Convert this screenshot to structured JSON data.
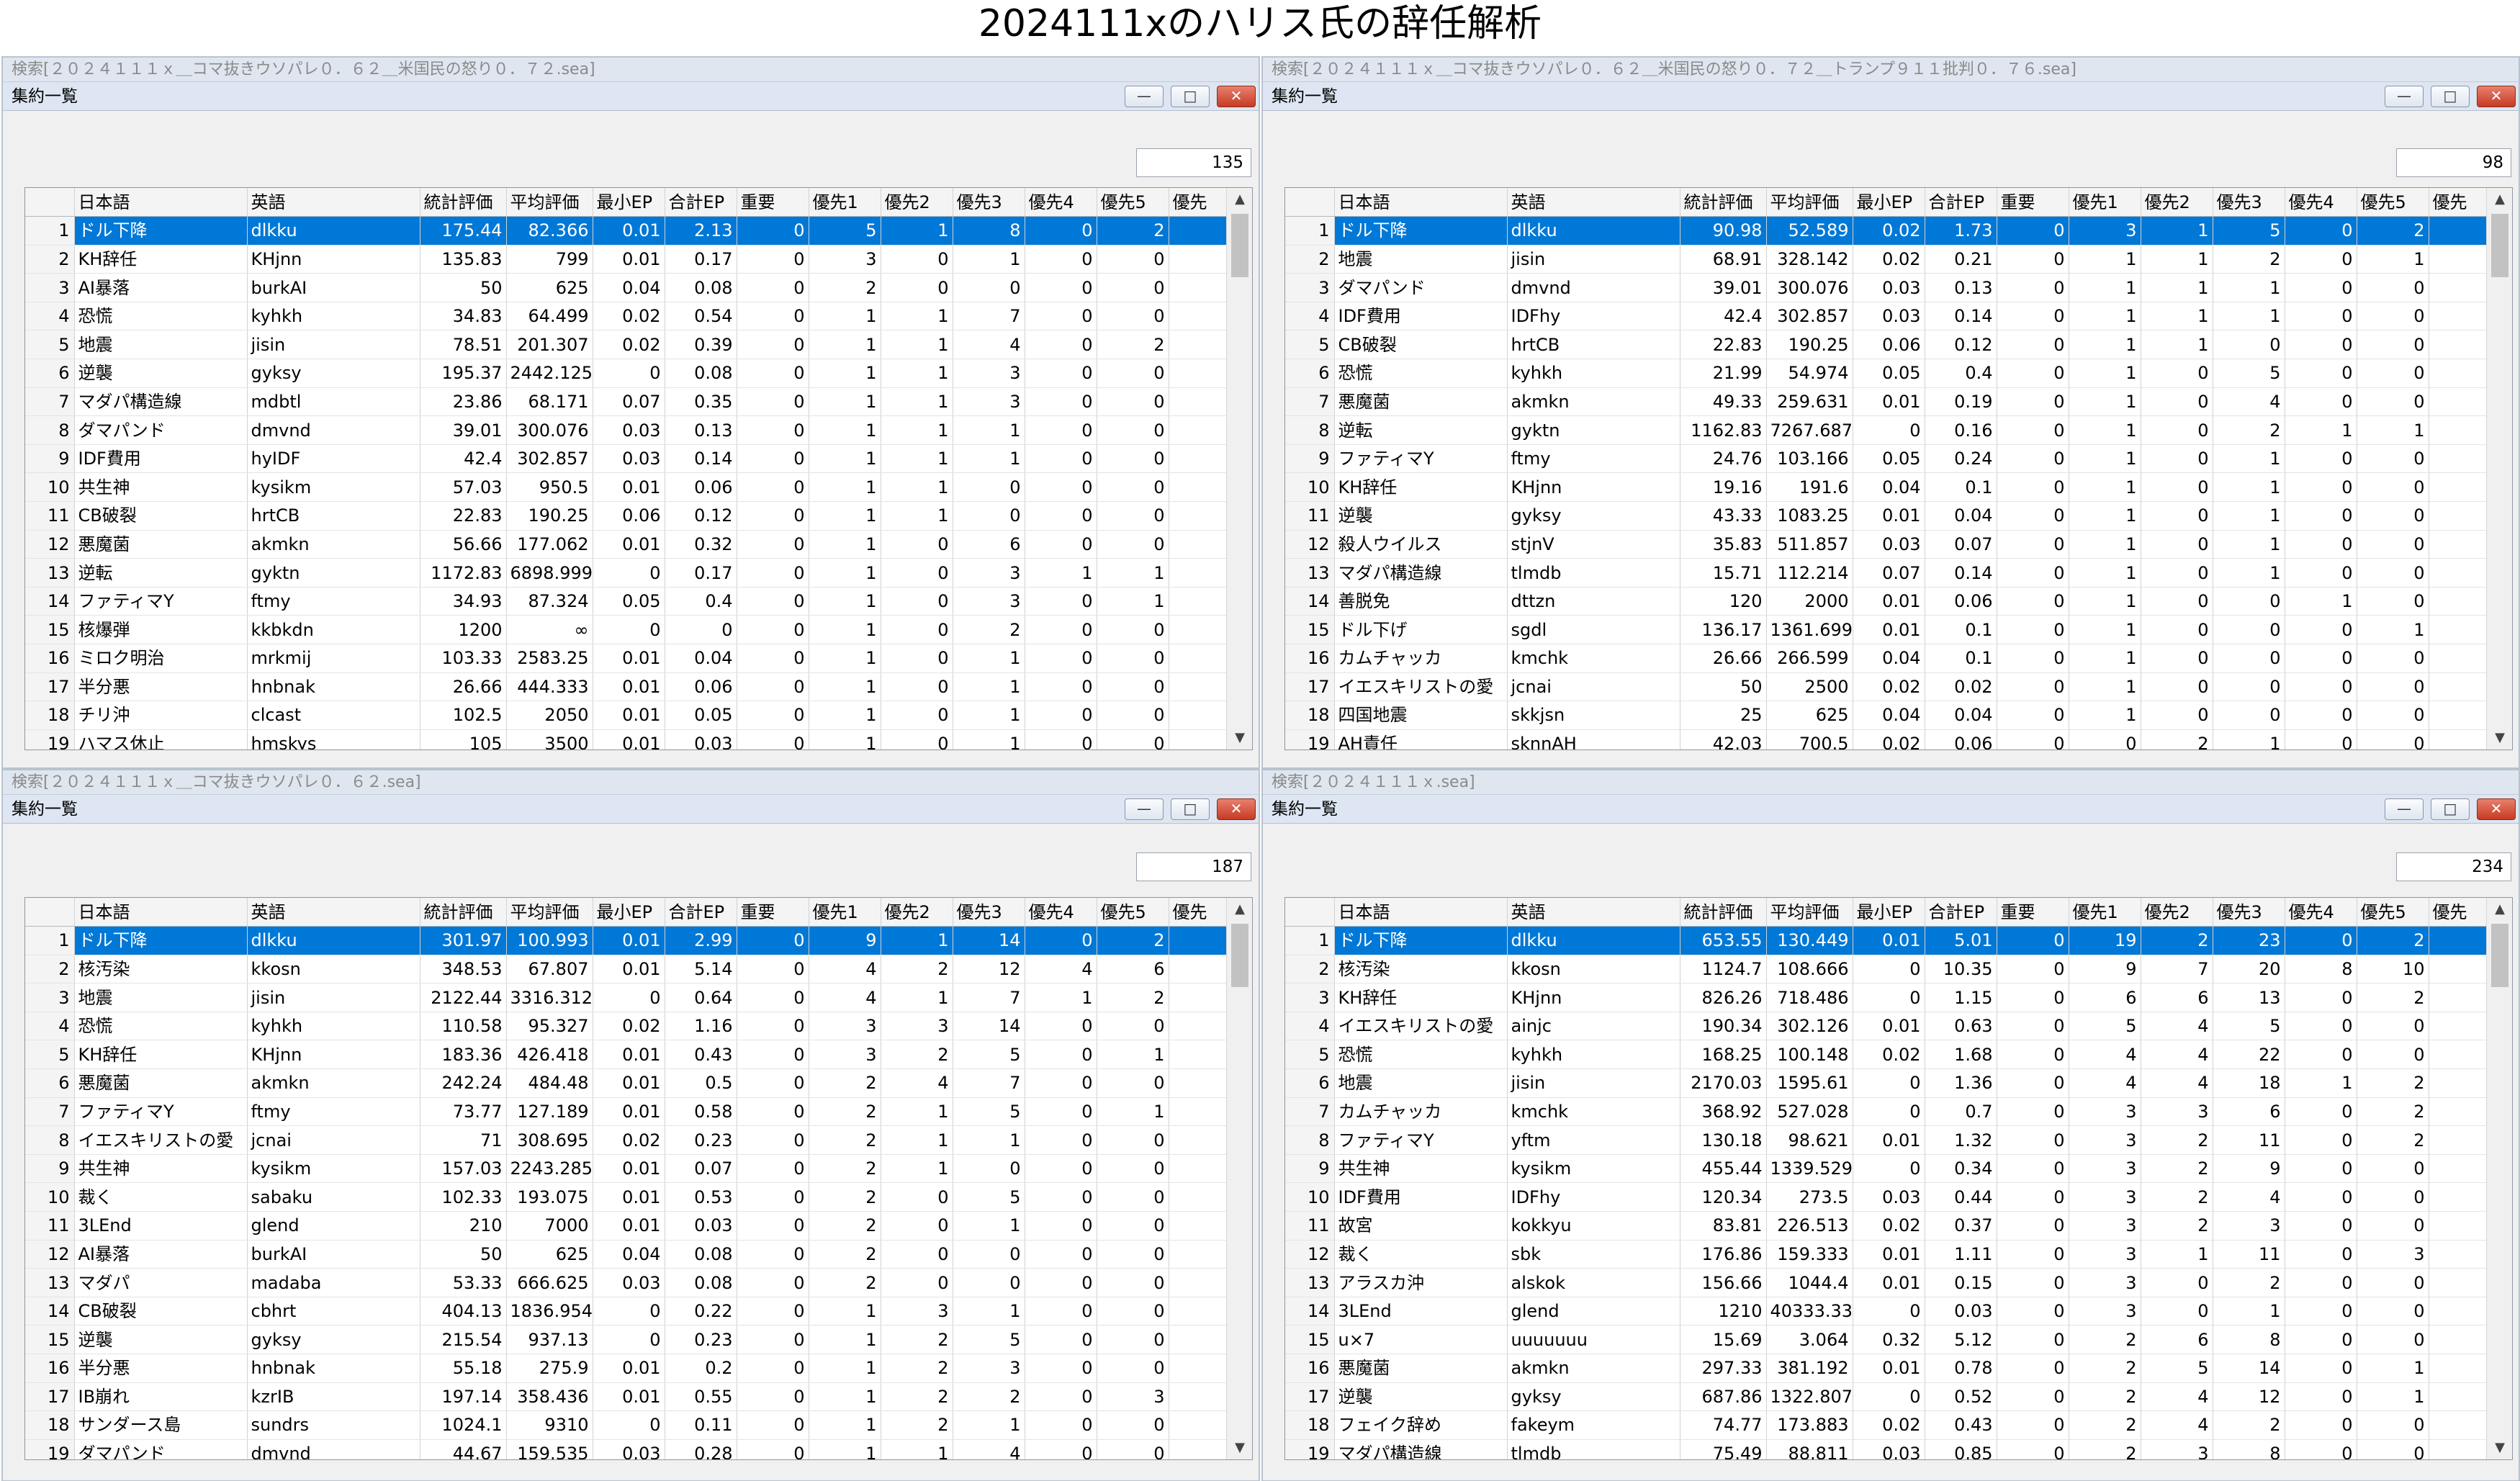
{
  "page_title": "2024111xのハリス氏の辞任解析",
  "columns": [
    "日本語",
    "英語",
    "統計評価",
    "平均評価",
    "最小EP",
    "合計EP",
    "重要",
    "優先1",
    "優先2",
    "優先3",
    "優先4",
    "優先5",
    "優先"
  ],
  "window_title": "集約一覧",
  "window_buttons": {
    "minimize": "—",
    "maximize": "□",
    "close": "✕"
  },
  "scroll": {
    "up": "▲",
    "down": "▼"
  },
  "panels": [
    {
      "outer_title": "検索[２０２４１１１ｘ＿コマ抜きウソパレ０．６２＿米国民の怒り０．７２.sea]",
      "count": "135",
      "rows": [
        [
          "1",
          "ドル下降",
          "dlkku",
          "175.44",
          "82.366",
          "0.01",
          "2.13",
          "0",
          "5",
          "1",
          "8",
          "0",
          "2"
        ],
        [
          "2",
          "KH辞任",
          "KHjnn",
          "135.83",
          "799",
          "0.01",
          "0.17",
          "0",
          "3",
          "0",
          "1",
          "0",
          "0"
        ],
        [
          "3",
          "AI暴落",
          "burkAI",
          "50",
          "625",
          "0.04",
          "0.08",
          "0",
          "2",
          "0",
          "0",
          "0",
          "0"
        ],
        [
          "4",
          "恐慌",
          "kyhkh",
          "34.83",
          "64.499",
          "0.02",
          "0.54",
          "0",
          "1",
          "1",
          "7",
          "0",
          "0"
        ],
        [
          "5",
          "地震",
          "jisin",
          "78.51",
          "201.307",
          "0.02",
          "0.39",
          "0",
          "1",
          "1",
          "4",
          "0",
          "2"
        ],
        [
          "6",
          "逆襲",
          "gyksy",
          "195.37",
          "2442.125",
          "0",
          "0.08",
          "0",
          "1",
          "1",
          "3",
          "0",
          "0"
        ],
        [
          "7",
          "マダパ構造線",
          "mdbtl",
          "23.86",
          "68.171",
          "0.07",
          "0.35",
          "0",
          "1",
          "1",
          "3",
          "0",
          "0"
        ],
        [
          "8",
          "ダマパンド",
          "dmvnd",
          "39.01",
          "300.076",
          "0.03",
          "0.13",
          "0",
          "1",
          "1",
          "1",
          "0",
          "0"
        ],
        [
          "9",
          "IDF費用",
          "hyIDF",
          "42.4",
          "302.857",
          "0.03",
          "0.14",
          "0",
          "1",
          "1",
          "1",
          "0",
          "0"
        ],
        [
          "10",
          "共生神",
          "kysikm",
          "57.03",
          "950.5",
          "0.01",
          "0.06",
          "0",
          "1",
          "1",
          "0",
          "0",
          "0"
        ],
        [
          "11",
          "CB破裂",
          "hrtCB",
          "22.83",
          "190.25",
          "0.06",
          "0.12",
          "0",
          "1",
          "1",
          "0",
          "0",
          "0"
        ],
        [
          "12",
          "悪魔菌",
          "akmkn",
          "56.66",
          "177.062",
          "0.01",
          "0.32",
          "0",
          "1",
          "0",
          "6",
          "0",
          "0"
        ],
        [
          "13",
          "逆転",
          "gyktn",
          "1172.83",
          "6898.999",
          "0",
          "0.17",
          "0",
          "1",
          "0",
          "3",
          "1",
          "1"
        ],
        [
          "14",
          "ファティマY",
          "ftmy",
          "34.93",
          "87.324",
          "0.05",
          "0.4",
          "0",
          "1",
          "0",
          "3",
          "0",
          "1"
        ],
        [
          "15",
          "核爆弾",
          "kkbkdn",
          "1200",
          "∞",
          "0",
          "0",
          "0",
          "1",
          "0",
          "2",
          "0",
          "0"
        ],
        [
          "16",
          "ミロク明治",
          "mrkmij",
          "103.33",
          "2583.25",
          "0.01",
          "0.04",
          "0",
          "1",
          "0",
          "1",
          "0",
          "0"
        ],
        [
          "17",
          "半分悪",
          "hnbnak",
          "26.66",
          "444.333",
          "0.01",
          "0.06",
          "0",
          "1",
          "0",
          "1",
          "0",
          "0"
        ],
        [
          "18",
          "チリ沖",
          "clcast",
          "102.5",
          "2050",
          "0.01",
          "0.05",
          "0",
          "1",
          "0",
          "1",
          "0",
          "0"
        ],
        [
          "19",
          "ハマス休止",
          "hmskys",
          "105",
          "3500",
          "0.01",
          "0.03",
          "0",
          "1",
          "0",
          "1",
          "0",
          "0"
        ]
      ]
    },
    {
      "outer_title": "検索[２０２４１１１ｘ＿コマ抜きウソパレ０．６２＿米国民の怒り０．７２＿トランプ９１１批判０．７６.sea]",
      "count": "98",
      "rows": [
        [
          "1",
          "ドル下降",
          "dlkku",
          "90.98",
          "52.589",
          "0.02",
          "1.73",
          "0",
          "3",
          "1",
          "5",
          "0",
          "2"
        ],
        [
          "2",
          "地震",
          "jisin",
          "68.91",
          "328.142",
          "0.02",
          "0.21",
          "0",
          "1",
          "1",
          "2",
          "0",
          "1"
        ],
        [
          "3",
          "ダマパンド",
          "dmvnd",
          "39.01",
          "300.076",
          "0.03",
          "0.13",
          "0",
          "1",
          "1",
          "1",
          "0",
          "0"
        ],
        [
          "4",
          "IDF費用",
          "IDFhy",
          "42.4",
          "302.857",
          "0.03",
          "0.14",
          "0",
          "1",
          "1",
          "1",
          "0",
          "0"
        ],
        [
          "5",
          "CB破裂",
          "hrtCB",
          "22.83",
          "190.25",
          "0.06",
          "0.12",
          "0",
          "1",
          "1",
          "0",
          "0",
          "0"
        ],
        [
          "6",
          "恐慌",
          "kyhkh",
          "21.99",
          "54.974",
          "0.05",
          "0.4",
          "0",
          "1",
          "0",
          "5",
          "0",
          "0"
        ],
        [
          "7",
          "悪魔菌",
          "akmkn",
          "49.33",
          "259.631",
          "0.01",
          "0.19",
          "0",
          "1",
          "0",
          "4",
          "0",
          "0"
        ],
        [
          "8",
          "逆転",
          "gyktn",
          "1162.83",
          "7267.687",
          "0",
          "0.16",
          "0",
          "1",
          "0",
          "2",
          "1",
          "1"
        ],
        [
          "9",
          "ファティマY",
          "ftmy",
          "24.76",
          "103.166",
          "0.05",
          "0.24",
          "0",
          "1",
          "0",
          "1",
          "0",
          "0"
        ],
        [
          "10",
          "KH辞任",
          "KHjnn",
          "19.16",
          "191.6",
          "0.04",
          "0.1",
          "0",
          "1",
          "0",
          "1",
          "0",
          "0"
        ],
        [
          "11",
          "逆襲",
          "gyksy",
          "43.33",
          "1083.25",
          "0.01",
          "0.04",
          "0",
          "1",
          "0",
          "1",
          "0",
          "0"
        ],
        [
          "12",
          "殺人ウイルス",
          "stjnV",
          "35.83",
          "511.857",
          "0.03",
          "0.07",
          "0",
          "1",
          "0",
          "1",
          "0",
          "0"
        ],
        [
          "13",
          "マダパ構造線",
          "tlmdb",
          "15.71",
          "112.214",
          "0.07",
          "0.14",
          "0",
          "1",
          "0",
          "1",
          "0",
          "0"
        ],
        [
          "14",
          "善脱免",
          "dttzn",
          "120",
          "2000",
          "0.01",
          "0.06",
          "0",
          "1",
          "0",
          "0",
          "1",
          "0"
        ],
        [
          "15",
          "ドル下げ",
          "sgdl",
          "136.17",
          "1361.699",
          "0.01",
          "0.1",
          "0",
          "1",
          "0",
          "0",
          "0",
          "1"
        ],
        [
          "16",
          "カムチャッカ",
          "kmchk",
          "26.66",
          "266.599",
          "0.04",
          "0.1",
          "0",
          "1",
          "0",
          "0",
          "0",
          "0"
        ],
        [
          "17",
          "イエスキリストの愛",
          "jcnai",
          "50",
          "2500",
          "0.02",
          "0.02",
          "0",
          "1",
          "0",
          "0",
          "0",
          "0"
        ],
        [
          "18",
          "四国地震",
          "skkjsn",
          "25",
          "625",
          "0.04",
          "0.04",
          "0",
          "1",
          "0",
          "0",
          "0",
          "0"
        ],
        [
          "19",
          "AH責任",
          "sknnAH",
          "42.03",
          "700.5",
          "0.02",
          "0.06",
          "0",
          "0",
          "2",
          "1",
          "0",
          "0"
        ]
      ]
    },
    {
      "outer_title": "検索[２０２４１１１ｘ＿コマ抜きウソパレ０．６２.sea]",
      "count": "187",
      "rows": [
        [
          "1",
          "ドル下降",
          "dlkku",
          "301.97",
          "100.993",
          "0.01",
          "2.99",
          "0",
          "9",
          "1",
          "14",
          "0",
          "2"
        ],
        [
          "2",
          "核汚染",
          "kkosn",
          "348.53",
          "67.807",
          "0.01",
          "5.14",
          "0",
          "4",
          "2",
          "12",
          "4",
          "6"
        ],
        [
          "3",
          "地震",
          "jisin",
          "2122.44",
          "3316.312",
          "0",
          "0.64",
          "0",
          "4",
          "1",
          "7",
          "1",
          "2"
        ],
        [
          "4",
          "恐慌",
          "kyhkh",
          "110.58",
          "95.327",
          "0.02",
          "1.16",
          "0",
          "3",
          "3",
          "14",
          "0",
          "0"
        ],
        [
          "5",
          "KH辞任",
          "KHjnn",
          "183.36",
          "426.418",
          "0.01",
          "0.43",
          "0",
          "3",
          "2",
          "5",
          "0",
          "1"
        ],
        [
          "6",
          "悪魔菌",
          "akmkn",
          "242.24",
          "484.48",
          "0.01",
          "0.5",
          "0",
          "2",
          "4",
          "7",
          "0",
          "0"
        ],
        [
          "7",
          "ファティマY",
          "ftmy",
          "73.77",
          "127.189",
          "0.01",
          "0.58",
          "0",
          "2",
          "1",
          "5",
          "0",
          "1"
        ],
        [
          "8",
          "イエスキリストの愛",
          "jcnai",
          "71",
          "308.695",
          "0.02",
          "0.23",
          "0",
          "2",
          "1",
          "1",
          "0",
          "0"
        ],
        [
          "9",
          "共生神",
          "kysikm",
          "157.03",
          "2243.285",
          "0.01",
          "0.07",
          "0",
          "2",
          "1",
          "0",
          "0",
          "0"
        ],
        [
          "10",
          "裁く",
          "sabaku",
          "102.33",
          "193.075",
          "0.01",
          "0.53",
          "0",
          "2",
          "0",
          "5",
          "0",
          "0"
        ],
        [
          "11",
          "3LEnd",
          "glend",
          "210",
          "7000",
          "0.01",
          "0.03",
          "0",
          "2",
          "0",
          "1",
          "0",
          "0"
        ],
        [
          "12",
          "AI暴落",
          "burkAI",
          "50",
          "625",
          "0.04",
          "0.08",
          "0",
          "2",
          "0",
          "0",
          "0",
          "0"
        ],
        [
          "13",
          "マダパ",
          "madaba",
          "53.33",
          "666.625",
          "0.03",
          "0.08",
          "0",
          "2",
          "0",
          "0",
          "0",
          "0"
        ],
        [
          "14",
          "CB破裂",
          "cbhrt",
          "404.13",
          "1836.954",
          "0",
          "0.22",
          "0",
          "1",
          "3",
          "1",
          "0",
          "0"
        ],
        [
          "15",
          "逆襲",
          "gyksy",
          "215.54",
          "937.13",
          "0",
          "0.23",
          "0",
          "1",
          "2",
          "5",
          "0",
          "0"
        ],
        [
          "16",
          "半分悪",
          "hnbnak",
          "55.18",
          "275.9",
          "0.01",
          "0.2",
          "0",
          "1",
          "2",
          "3",
          "0",
          "0"
        ],
        [
          "17",
          "IB崩れ",
          "kzrIB",
          "197.14",
          "358.436",
          "0.01",
          "0.55",
          "0",
          "1",
          "2",
          "2",
          "0",
          "3"
        ],
        [
          "18",
          "サンダース島",
          "sundrs",
          "1024.1",
          "9310",
          "0",
          "0.11",
          "0",
          "1",
          "2",
          "1",
          "0",
          "0"
        ],
        [
          "19",
          "ダマパンド",
          "dmvnd",
          "44.67",
          "159.535",
          "0.03",
          "0.28",
          "0",
          "1",
          "1",
          "4",
          "0",
          "0"
        ]
      ]
    },
    {
      "outer_title": "検索[２０２４１１１ｘ.sea]",
      "count": "234",
      "rows": [
        [
          "1",
          "ドル下降",
          "dlkku",
          "653.55",
          "130.449",
          "0.01",
          "5.01",
          "0",
          "19",
          "2",
          "23",
          "0",
          "2"
        ],
        [
          "2",
          "核汚染",
          "kkosn",
          "1124.7",
          "108.666",
          "0",
          "10.35",
          "0",
          "9",
          "7",
          "20",
          "8",
          "10"
        ],
        [
          "3",
          "KH辞任",
          "KHjnn",
          "826.26",
          "718.486",
          "0",
          "1.15",
          "0",
          "6",
          "6",
          "13",
          "0",
          "2"
        ],
        [
          "4",
          "イエスキリストの愛",
          "ainjc",
          "190.34",
          "302.126",
          "0.01",
          "0.63",
          "0",
          "5",
          "4",
          "5",
          "0",
          "0"
        ],
        [
          "5",
          "恐慌",
          "kyhkh",
          "168.25",
          "100.148",
          "0.02",
          "1.68",
          "0",
          "4",
          "4",
          "22",
          "0",
          "0"
        ],
        [
          "6",
          "地震",
          "jisin",
          "2170.03",
          "1595.61",
          "0",
          "1.36",
          "0",
          "4",
          "4",
          "18",
          "1",
          "2"
        ],
        [
          "7",
          "カムチャッカ",
          "kmchk",
          "368.92",
          "527.028",
          "0",
          "0.7",
          "0",
          "3",
          "3",
          "6",
          "0",
          "2"
        ],
        [
          "8",
          "ファティマY",
          "yftm",
          "130.18",
          "98.621",
          "0.01",
          "1.32",
          "0",
          "3",
          "2",
          "11",
          "0",
          "2"
        ],
        [
          "9",
          "共生神",
          "kysikm",
          "455.44",
          "1339.529",
          "0",
          "0.34",
          "0",
          "3",
          "2",
          "9",
          "0",
          "0"
        ],
        [
          "10",
          "IDF費用",
          "IDFhy",
          "120.34",
          "273.5",
          "0.03",
          "0.44",
          "0",
          "3",
          "2",
          "4",
          "0",
          "0"
        ],
        [
          "11",
          "故宮",
          "kokkyu",
          "83.81",
          "226.513",
          "0.02",
          "0.37",
          "0",
          "3",
          "2",
          "3",
          "0",
          "0"
        ],
        [
          "12",
          "裁く",
          "sbk",
          "176.86",
          "159.333",
          "0.01",
          "1.11",
          "0",
          "3",
          "1",
          "11",
          "0",
          "3"
        ],
        [
          "13",
          "アラスカ沖",
          "alskok",
          "156.66",
          "1044.4",
          "0.01",
          "0.15",
          "0",
          "3",
          "0",
          "2",
          "0",
          "0"
        ],
        [
          "14",
          "3LEnd",
          "glend",
          "1210",
          "40333.333",
          "0",
          "0.03",
          "0",
          "3",
          "0",
          "1",
          "0",
          "0"
        ],
        [
          "15",
          "u×7",
          "uuuuuuu",
          "15.69",
          "3.064",
          "0.32",
          "5.12",
          "0",
          "2",
          "6",
          "8",
          "0",
          "0"
        ],
        [
          "16",
          "悪魔菌",
          "akmkn",
          "297.33",
          "381.192",
          "0.01",
          "0.78",
          "0",
          "2",
          "5",
          "14",
          "0",
          "1"
        ],
        [
          "17",
          "逆襲",
          "gyksy",
          "687.86",
          "1322.807",
          "0",
          "0.52",
          "0",
          "2",
          "4",
          "12",
          "0",
          "1"
        ],
        [
          "18",
          "フェイク辞め",
          "fakeym",
          "74.77",
          "173.883",
          "0.02",
          "0.43",
          "0",
          "2",
          "4",
          "2",
          "0",
          "0"
        ],
        [
          "19",
          "マダパ構造線",
          "tlmdb",
          "75.49",
          "88.811",
          "0.03",
          "0.85",
          "0",
          "2",
          "3",
          "8",
          "0",
          "0"
        ]
      ]
    }
  ]
}
